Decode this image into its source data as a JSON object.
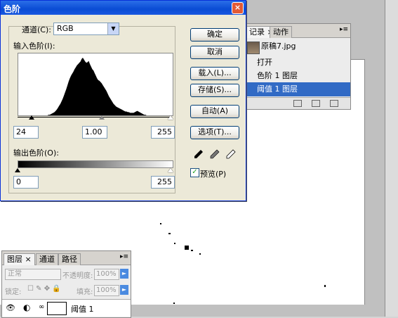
{
  "levels_dialog": {
    "title": "色阶",
    "close_glyph": "×",
    "channel_label": "通道(C):",
    "channel_value": "RGB",
    "input_levels_label": "输入色阶(I):",
    "input_black": "24",
    "input_gamma": "1.00",
    "input_white": "255",
    "output_levels_label": "输出色阶(O):",
    "output_black": "0",
    "output_white": "255",
    "buttons": {
      "ok": "确定",
      "cancel": "取消",
      "load": "载入(L)...",
      "save": "存储(S)...",
      "auto": "自动(A)",
      "options": "选项(T)..."
    },
    "preview_label": "预览(P)",
    "preview_checked": true,
    "histogram_levels": [
      0,
      0,
      0,
      0,
      0,
      0,
      0,
      0,
      0,
      1,
      1,
      2,
      3,
      4,
      5,
      7,
      9,
      12,
      15,
      18,
      22,
      26,
      31,
      36,
      41,
      47,
      53,
      58,
      62,
      65,
      68,
      72,
      75,
      78,
      80,
      82,
      84,
      88,
      90,
      87,
      84,
      82,
      83,
      85,
      80,
      76,
      72,
      70,
      66,
      62,
      58,
      55,
      54,
      52,
      50,
      47,
      44,
      41,
      38,
      34,
      30,
      27,
      24,
      21,
      18,
      16,
      14,
      13,
      12,
      11,
      10,
      9,
      8,
      7,
      6,
      6,
      5,
      5,
      4,
      4,
      4,
      4,
      5,
      6,
      7,
      6,
      5,
      4,
      3,
      2,
      1,
      1,
      0,
      0,
      0,
      0
    ]
  },
  "history_panel": {
    "tabs": [
      "记录",
      "动作"
    ],
    "tab_close": "×",
    "snapshot": "原稿7.jpg",
    "items": [
      "打开",
      "色阶 1 图层",
      "阈值 1 图层"
    ],
    "selected_index": 2
  },
  "layers_panel": {
    "tabs": [
      "图层",
      "通道",
      "路径"
    ],
    "tab_close": "×",
    "blend_mode": "正常",
    "opacity_label": "不透明度:",
    "opacity_value": "100%",
    "lock_label": "锁定:",
    "fill_label": "填充:",
    "fill_value": "100%",
    "layer_name": "阈值 1"
  },
  "colors": {
    "title_blue": "#0a4cd4",
    "selection_blue": "#316ac5",
    "dialog_bg": "#ece9d8"
  }
}
